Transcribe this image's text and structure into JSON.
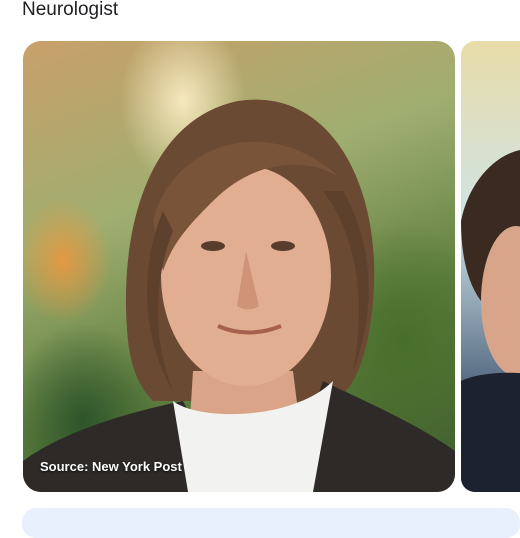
{
  "section": {
    "heading": "Neurologist"
  },
  "carousel": {
    "cards": [
      {
        "caption": "Source: New York Post"
      },
      {
        "caption": ""
      }
    ]
  },
  "colors": {
    "caption_text": "#ffffff",
    "heading_text": "#202124",
    "next_card_bg": "#e8f0fe"
  }
}
